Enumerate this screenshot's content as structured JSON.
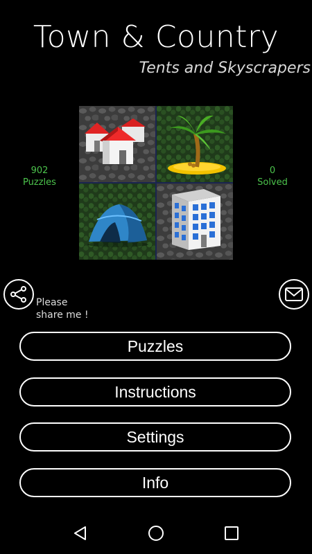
{
  "header": {
    "title": "Town & Country",
    "subtitle": "Tents and Skyscrapers"
  },
  "stats": {
    "puzzles_count": "902",
    "puzzles_label": "Puzzles",
    "solved_count": "0",
    "solved_label": "Solved"
  },
  "tiles": [
    {
      "icon": "houses-icon",
      "background": "cobblestone"
    },
    {
      "icon": "palm-island-icon",
      "background": "grass"
    },
    {
      "icon": "tent-icon",
      "background": "grass"
    },
    {
      "icon": "skyscraper-icon",
      "background": "cobblestone"
    }
  ],
  "share": {
    "icon": "share-icon",
    "text_line1": "Please",
    "text_line2": "share me !"
  },
  "mail": {
    "icon": "mail-icon"
  },
  "menu": {
    "puzzles": "Puzzles",
    "instructions": "Instructions",
    "settings": "Settings",
    "info": "Info"
  },
  "navbar": {
    "back_icon": "back-icon",
    "home_icon": "home-icon",
    "recents_icon": "recents-icon"
  },
  "colors": {
    "accent_green": "#4cc34c",
    "background": "#000000",
    "text": "#ffffff"
  }
}
